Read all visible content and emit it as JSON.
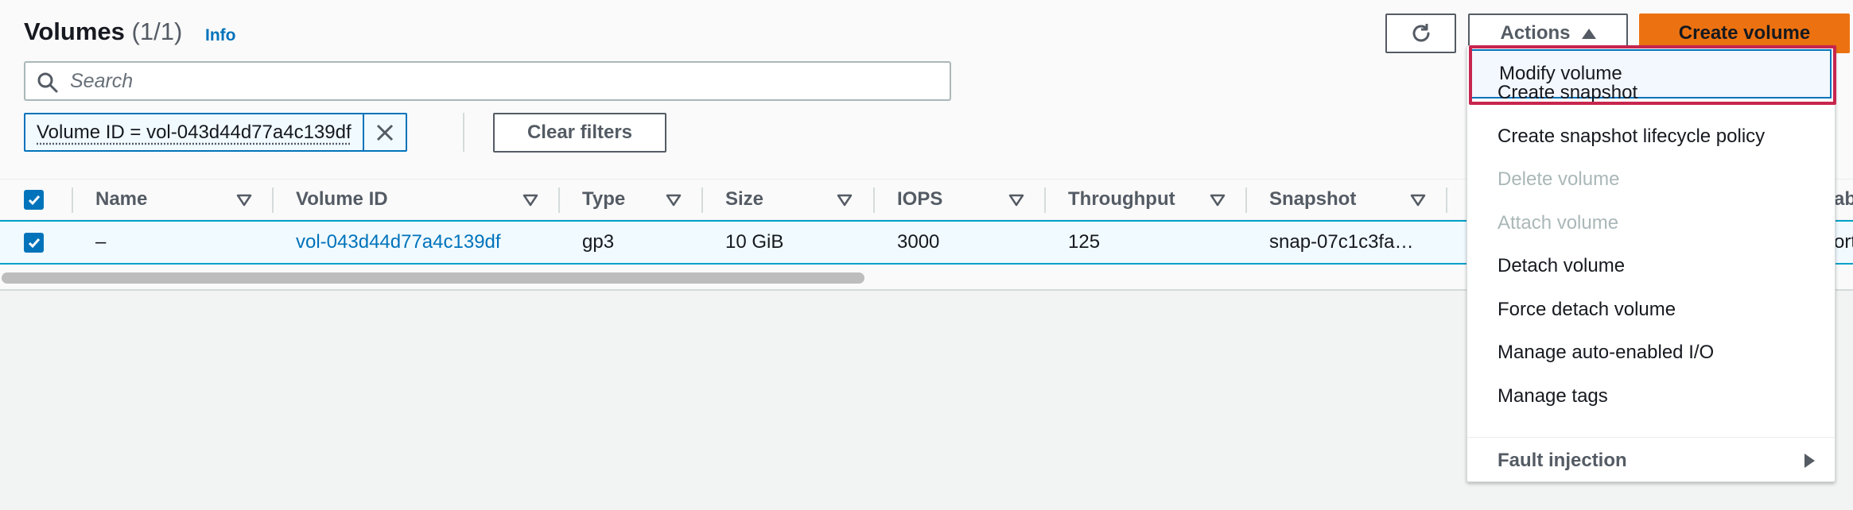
{
  "header": {
    "title": "Volumes",
    "count": "(1/1)",
    "info": "Info"
  },
  "toolbar": {
    "actions_label": "Actions",
    "create_label": "Create volume",
    "refresh_icon": "refresh-icon"
  },
  "search": {
    "placeholder": "Search",
    "value": ""
  },
  "filter": {
    "token": "Volume ID = vol-043d44d77a4c139df",
    "clear_label": "Clear filters"
  },
  "table": {
    "columns": [
      "Name",
      "Volume ID",
      "Type",
      "Size",
      "IOPS",
      "Throughput",
      "Snapshot"
    ],
    "rows": [
      {
        "name": "–",
        "volume_id": "vol-043d44d77a4c139df",
        "type": "gp3",
        "size": "10 GiB",
        "iops": "3000",
        "throughput": "125",
        "snapshot": "snap-07c1c3fa…",
        "overflow_header": "ab",
        "overflow_cell": "ort",
        "selected": true
      }
    ]
  },
  "menu": {
    "items": [
      {
        "label": "Modify volume",
        "state": "hover"
      },
      {
        "label": "Create snapshot",
        "state": "enabled"
      },
      {
        "label": "Create snapshot lifecycle policy",
        "state": "enabled"
      },
      {
        "label": "Delete volume",
        "state": "disabled"
      },
      {
        "label": "Attach volume",
        "state": "disabled"
      },
      {
        "label": "Detach volume",
        "state": "enabled"
      },
      {
        "label": "Force detach volume",
        "state": "enabled"
      },
      {
        "label": "Manage auto-enabled I/O",
        "state": "enabled"
      },
      {
        "label": "Manage tags",
        "state": "enabled"
      }
    ],
    "group_label": "Fault injection"
  },
  "colors": {
    "accent": "#0073bb",
    "primary_button": "#ec7211",
    "highlight_box": "#c7254e"
  }
}
